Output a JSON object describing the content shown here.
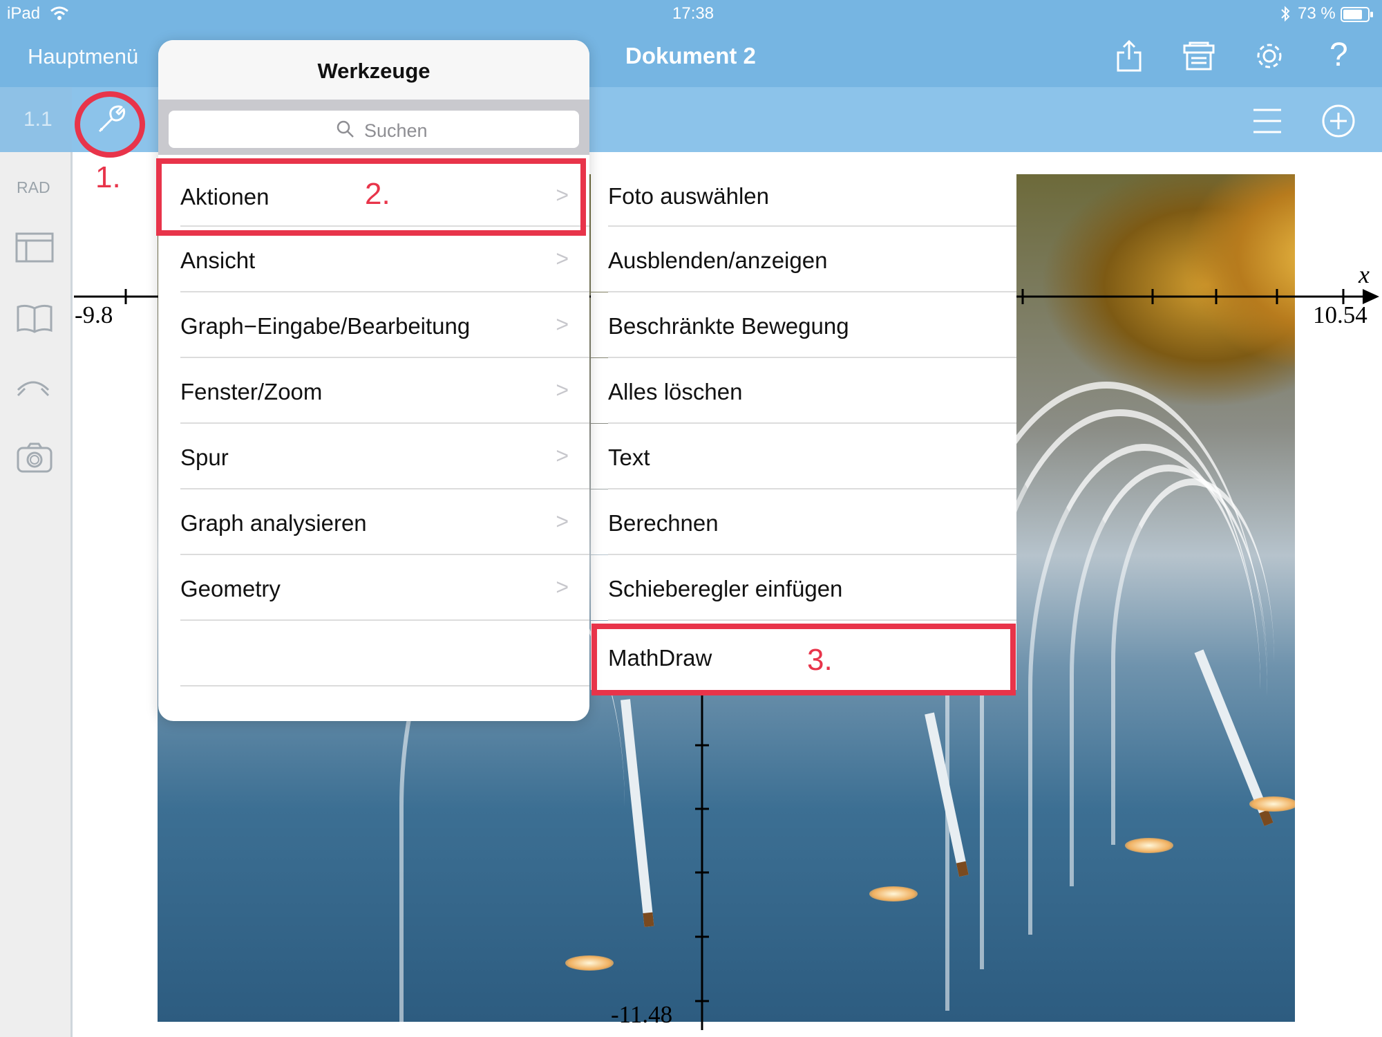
{
  "status_bar": {
    "device": "iPad",
    "time": "17:38",
    "battery": "73 %",
    "icons": [
      "wifi-icon",
      "bluetooth-icon",
      "battery-icon"
    ]
  },
  "nav_bar": {
    "home_label": "Hauptmenü",
    "document_title": "Dokument 2",
    "icons": [
      "share-icon",
      "documents-icon",
      "settings-icon",
      "help-icon"
    ]
  },
  "toolbar": {
    "page_tab": "1.1",
    "icons": [
      "wrench-icon",
      "menu-icon",
      "add-icon"
    ]
  },
  "sidebar": {
    "angle_mode": "RAD",
    "icons": [
      "layout-icon",
      "book-icon",
      "switch-icon",
      "camera-icon"
    ]
  },
  "graph": {
    "x_min": "-9.8",
    "x_max": "10.54",
    "y_min": "-11.48",
    "x_axis_label": "x"
  },
  "popover": {
    "title": "Werkzeuge",
    "search_placeholder": "Suchen",
    "items": [
      {
        "label": "Aktionen"
      },
      {
        "label": "Ansicht"
      },
      {
        "label": "Graph−Eingabe/Bearbeitung"
      },
      {
        "label": "Fenster/Zoom"
      },
      {
        "label": "Spur"
      },
      {
        "label": "Graph analysieren"
      },
      {
        "label": "Geometry"
      }
    ]
  },
  "submenu": {
    "items": [
      {
        "label": "Foto auswählen"
      },
      {
        "label": "Ausblenden/anzeigen"
      },
      {
        "label": "Beschränkte Bewegung"
      },
      {
        "label": "Alles löschen"
      },
      {
        "label": "Text"
      },
      {
        "label": "Berechnen"
      },
      {
        "label": "Schieberegler einfügen"
      },
      {
        "label": "MathDraw"
      }
    ]
  },
  "annotations": {
    "step1": "1.",
    "step2": "2.",
    "step3": "3.",
    "color": "#e8344a"
  },
  "colors": {
    "nav_bar": "#76b5e2",
    "toolbar": "#8cc3ea",
    "sidebar": "#eeeeee"
  }
}
